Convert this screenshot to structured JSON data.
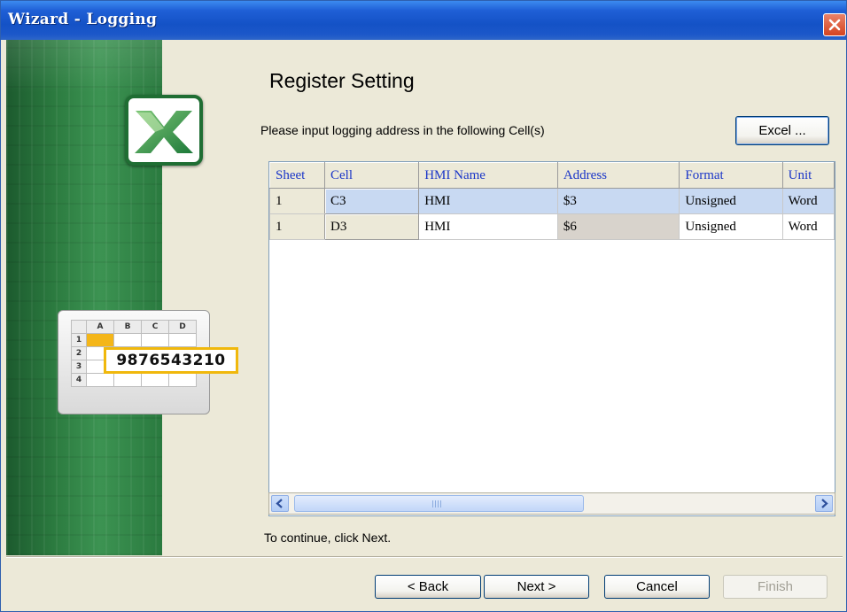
{
  "window": {
    "title": "Wizard - Logging"
  },
  "side_panel": {
    "sheet_columns": [
      "A",
      "B",
      "C",
      "D"
    ],
    "sheet_rows": [
      "1",
      "2",
      "3",
      "4"
    ],
    "sample_value": "9876543210"
  },
  "page": {
    "heading": "Register Setting",
    "instruction": "Please input logging address in the following Cell(s)",
    "excel_button": "Excel ...",
    "continue_hint": "To continue, click Next."
  },
  "grid": {
    "columns": [
      "Sheet",
      "Cell",
      "HMI Name",
      "Address",
      "Format",
      "Unit"
    ],
    "rows": [
      {
        "sheet": "1",
        "cell": "C3",
        "hmi_name": "HMI",
        "address": "$3",
        "format": "Unsigned",
        "unit": "Word"
      },
      {
        "sheet": "1",
        "cell": "D3",
        "hmi_name": "HMI",
        "address": "$6",
        "format": "Unsigned",
        "unit": "Word"
      }
    ]
  },
  "footer": {
    "back": "< Back",
    "next": "Next >",
    "cancel": "Cancel",
    "finish": "Finish"
  },
  "colors": {
    "title_bar": "#1452c6",
    "header_text": "#1b36c8",
    "selected_row": "#c8d9f2",
    "side_panel": "#2b7a3f"
  },
  "icons": [
    "close-icon",
    "excel-logo-icon",
    "scroll-left-icon",
    "scroll-right-icon"
  ]
}
